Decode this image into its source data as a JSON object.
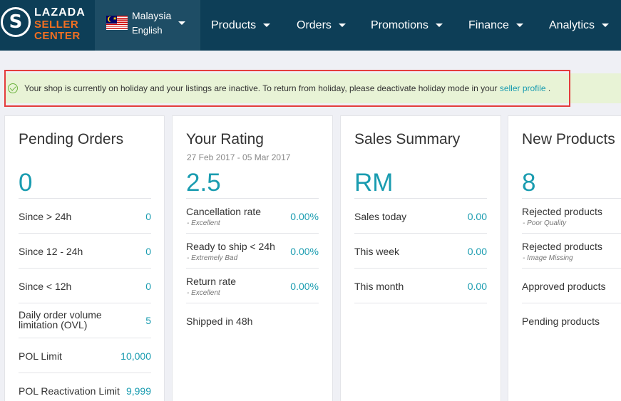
{
  "brand": {
    "line1": "LAZADA",
    "line2": "SELLER",
    "line3": "CENTER",
    "mark": "S"
  },
  "country": {
    "name": "Malaysia",
    "language": "English",
    "flag_icon": "malaysia-flag-icon"
  },
  "nav": [
    {
      "label": "Products"
    },
    {
      "label": "Orders"
    },
    {
      "label": "Promotions"
    },
    {
      "label": "Finance"
    },
    {
      "label": "Analytics"
    }
  ],
  "banner": {
    "text": "Your shop is currently on holiday and your listings are inactive. To return from holiday, please deactivate holiday mode in your ",
    "link": "seller profile",
    "suffix": " .",
    "icon": "check-circle-icon"
  },
  "pending_orders": {
    "title": "Pending Orders",
    "value": "0",
    "rows": [
      {
        "label": "Since > 24h",
        "value": "0"
      },
      {
        "label": "Since 12 - 24h",
        "value": "0"
      },
      {
        "label": "Since < 12h",
        "value": "0"
      },
      {
        "label": "Daily order volume limitation (OVL)",
        "value": "5"
      },
      {
        "label": "POL Limit",
        "value": "10,000"
      },
      {
        "label": "POL Reactivation Limit",
        "value": "9,999"
      }
    ]
  },
  "your_rating": {
    "title": "Your Rating",
    "date_range": "27 Feb 2017 - 05 Mar 2017",
    "value": "2.5",
    "rows": [
      {
        "label": "Cancellation rate",
        "sub": "- Excellent",
        "value": "0.00%"
      },
      {
        "label": "Ready to ship < 24h",
        "sub": "- Extremely Bad",
        "value": "0.00%"
      },
      {
        "label": "Return rate",
        "sub": "- Excellent",
        "value": "0.00%"
      },
      {
        "label": "Shipped in 48h",
        "value": ""
      }
    ]
  },
  "sales_summary": {
    "title": "Sales Summary",
    "value": "RM",
    "rows": [
      {
        "label": "Sales today",
        "value": "0.00"
      },
      {
        "label": "This week",
        "value": "0.00"
      },
      {
        "label": "This month",
        "value": "0.00"
      }
    ]
  },
  "new_products": {
    "title": "New Products",
    "value": "8",
    "rows": [
      {
        "label": "Rejected products",
        "sub": "- Poor Quality"
      },
      {
        "label": "Rejected products",
        "sub": "- Image Missing"
      },
      {
        "label": "Approved products"
      },
      {
        "label": "Pending products"
      }
    ]
  },
  "colors": {
    "nav_bg": "#0d3e57",
    "accent": "#1a9cb0",
    "brand_orange": "#f36f21",
    "banner_bg": "#e8f3d6",
    "highlight": "#e43c3c"
  }
}
